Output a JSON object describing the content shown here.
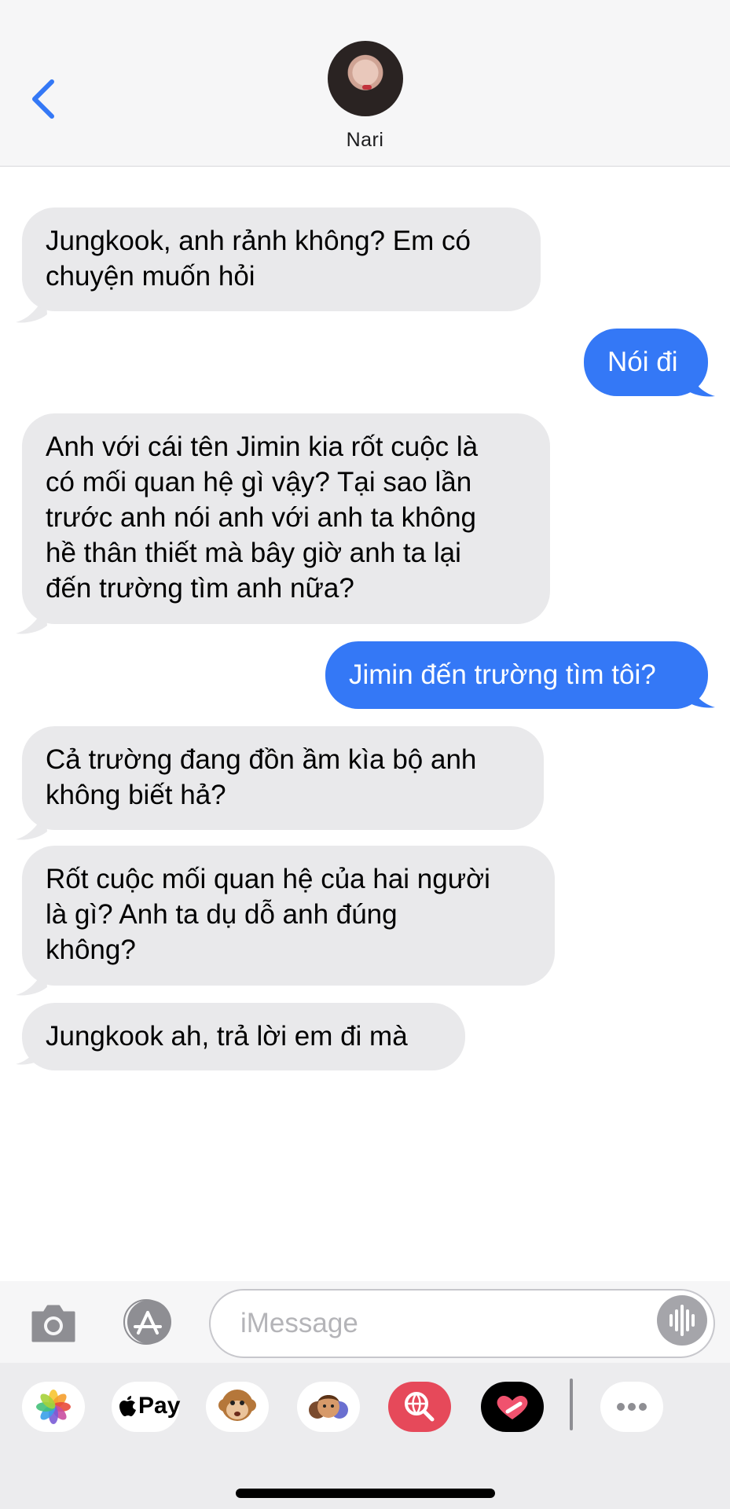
{
  "header": {
    "contact_name": "Nari",
    "back_icon": "chevron-left-icon",
    "avatar": "contact-avatar"
  },
  "messages": [
    {
      "direction": "incoming",
      "text_lines": [
        "Jungkook, anh rảnh không? Em có",
        "chuyện muốn hỏi"
      ]
    },
    {
      "direction": "outgoing",
      "text_lines": [
        "Nói đi"
      ]
    },
    {
      "direction": "incoming",
      "text_lines": [
        "Anh với cái tên Jimin kia rốt cuộc là",
        "có mối quan hệ gì vậy? Tại sao lần",
        "trước anh nói anh với anh ta không",
        "hề thân thiết mà bây giờ anh ta lại",
        "đến trường tìm anh nữa?"
      ]
    },
    {
      "direction": "outgoing",
      "text_lines": [
        "Jimin đến trường tìm tôi?"
      ]
    },
    {
      "direction": "incoming",
      "text_lines": [
        "Cả trường đang đồn ầm kìa bộ anh",
        "không biết hả?"
      ]
    },
    {
      "direction": "incoming",
      "text_lines": [
        "Rốt cuộc mối quan hệ của hai người",
        "là gì? Anh ta dụ dỗ anh đúng",
        "không?"
      ]
    },
    {
      "direction": "incoming",
      "text_lines": [
        "Jungkook ah, trả lời em đi mà"
      ]
    }
  ],
  "input": {
    "placeholder": "iMessage",
    "camera_icon": "camera-icon",
    "apps_icon": "app-store-icon",
    "audio_icon": "audio-waveform-icon"
  },
  "apps": [
    {
      "name": "photos",
      "icon": "photos-icon"
    },
    {
      "name": "apple-pay",
      "label": "Pay",
      "icon": "apple-logo-icon"
    },
    {
      "name": "animoji",
      "icon": "monkey-icon"
    },
    {
      "name": "memoji",
      "icon": "memoji-stickers-icon"
    },
    {
      "name": "images-search",
      "icon": "globe-search-icon"
    },
    {
      "name": "digital-touch",
      "icon": "heart-touch-icon"
    },
    {
      "name": "more",
      "icon": "more-dots-icon"
    }
  ],
  "colors": {
    "outgoing_bubble": "#3478f6",
    "incoming_bubble": "#e9e9eb",
    "accent": "#3478f6"
  }
}
